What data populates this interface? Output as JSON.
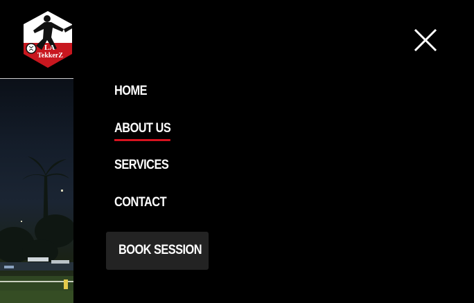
{
  "brand": {
    "logo_line1": "LA",
    "logo_line2": "TekkerZ",
    "logo_colors": {
      "top": "#ffffff",
      "bottom": "#c8171f"
    }
  },
  "menu": {
    "items": [
      {
        "label": "HOME",
        "active": false
      },
      {
        "label": "ABOUT US",
        "active": true
      },
      {
        "label": "SERVICES",
        "active": false
      },
      {
        "label": "CONTACT",
        "active": false
      }
    ],
    "cta_label": "BOOK SESSION",
    "close_icon": "close-icon",
    "accent_color": "#d7131f"
  }
}
